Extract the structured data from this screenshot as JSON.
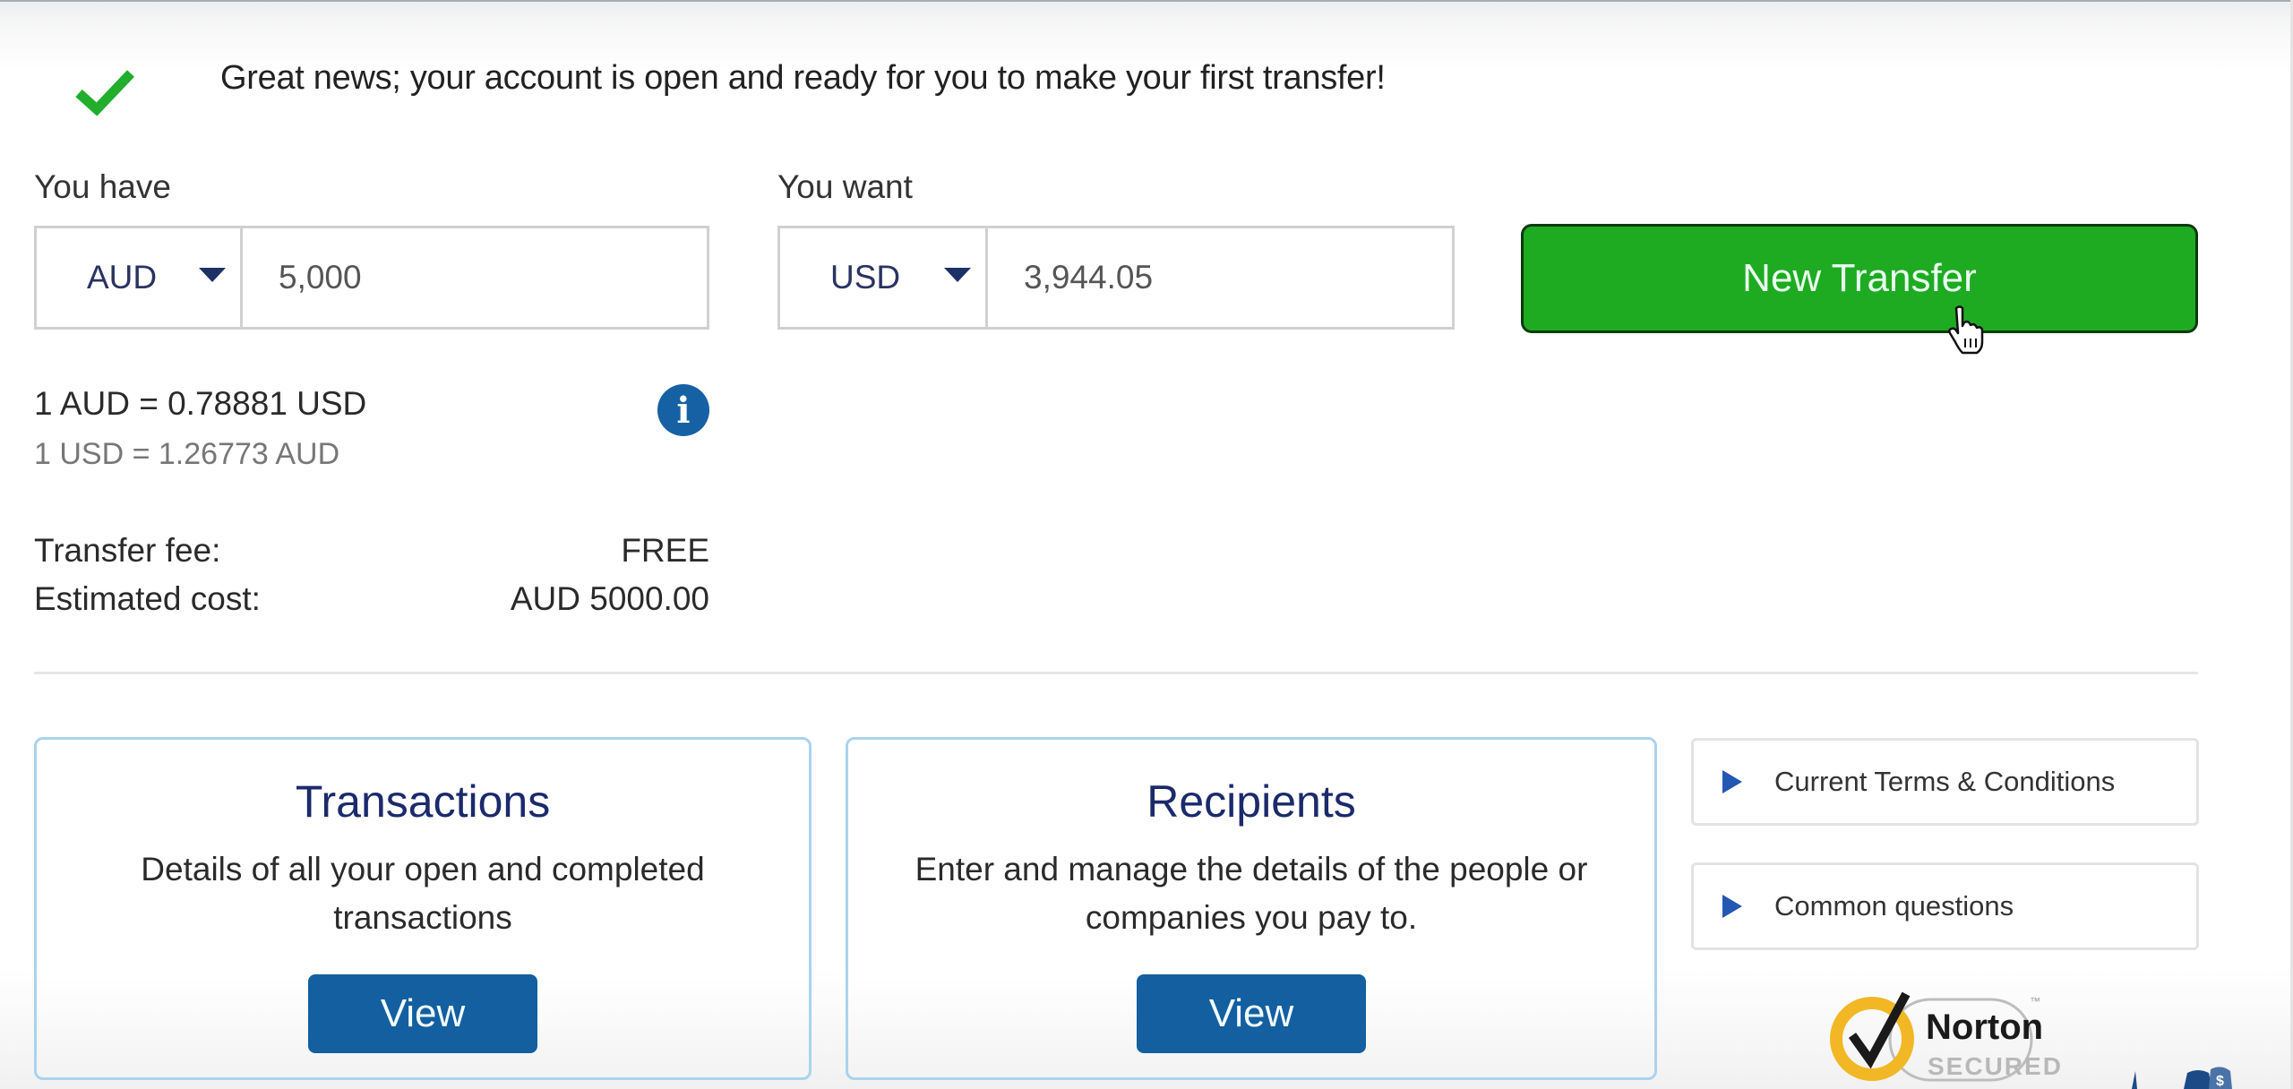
{
  "banner": {
    "icon": "checkmark-icon",
    "message": "Great news; your account is open and ready for you to make your first transfer!"
  },
  "converter": {
    "have": {
      "label": "You have",
      "currency": "AUD",
      "amount": "5,000"
    },
    "want": {
      "label": "You want",
      "currency": "USD",
      "amount": "3,944.05"
    },
    "new_transfer_label": "New Transfer",
    "rate_main": "1 AUD = 0.78881 USD",
    "rate_inverse": "1 USD = 1.26773 AUD",
    "info_icon_glyph": "i",
    "fee_label": "Transfer fee:",
    "fee_value": "FREE",
    "cost_label": "Estimated cost:",
    "cost_value": "AUD 5000.00"
  },
  "cards": [
    {
      "title": "Transactions",
      "description": "Details of all your open and completed transactions",
      "button": "View"
    },
    {
      "title": "Recipients",
      "description": "Enter and manage the details of the people or companies you pay to.",
      "button": "View"
    }
  ],
  "side_links": [
    {
      "label": "Current Terms & Conditions"
    },
    {
      "label": "Common questions"
    }
  ],
  "badge": {
    "name": "Norton",
    "sub": "SECURED",
    "tm": "™"
  },
  "colors": {
    "success_green": "#1eab22",
    "primary_blue": "#135f9f",
    "heading_navy": "#1b2a6b",
    "link_triangle": "#2456b4",
    "norton_yellow": "#f2b724"
  }
}
